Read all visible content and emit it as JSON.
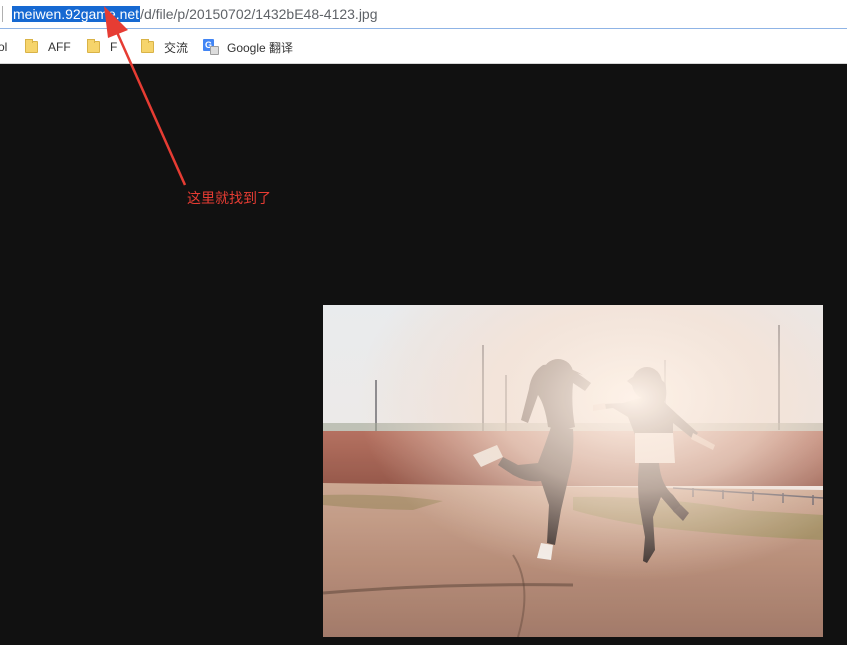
{
  "address_bar": {
    "url_host": "meiwen.92game.net",
    "url_path": "/d/file/p/20150702/1432bE48-4123.jpg"
  },
  "bookmarks": {
    "items": [
      {
        "label": "ol",
        "icon": "none"
      },
      {
        "label": "AFF",
        "icon": "folder-icon"
      },
      {
        "label": "F",
        "icon": "folder-icon"
      },
      {
        "label": "交流",
        "icon": "folder-icon"
      },
      {
        "label": "Google 翻译",
        "icon": "google-translate-icon"
      }
    ]
  },
  "annotation": {
    "text": "这里就找到了",
    "color": "#e63c33"
  },
  "colors": {
    "page_background": "#111111",
    "url_highlight": "#1669d2"
  }
}
